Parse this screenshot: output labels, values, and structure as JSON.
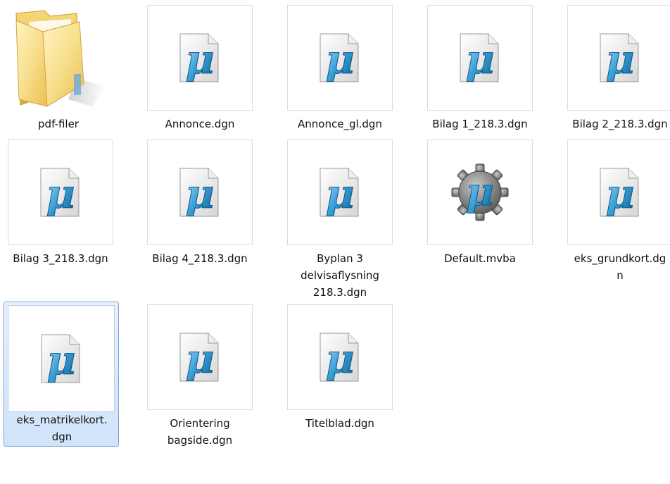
{
  "explorer": {
    "items": [
      {
        "label": "pdf-filer",
        "icon": "folder-icon"
      },
      {
        "label": "Annonce.dgn",
        "icon": "microstation-dgn-icon"
      },
      {
        "label": "Annonce_gl.dgn",
        "icon": "microstation-dgn-icon"
      },
      {
        "label": "Bilag 1_218.3.dgn",
        "icon": "microstation-dgn-icon"
      },
      {
        "label": "Bilag 2_218.3.dgn",
        "icon": "microstation-dgn-icon"
      },
      {
        "label": "Bilag 3_218.3.dgn",
        "icon": "microstation-dgn-icon"
      },
      {
        "label": "Bilag 4_218.3.dgn",
        "icon": "microstation-dgn-icon"
      },
      {
        "label": "Byplan 3\ndelvisaflysning\n218.3.dgn",
        "icon": "microstation-dgn-icon"
      },
      {
        "label": "Default.mvba",
        "icon": "microstation-vba-gear-icon"
      },
      {
        "label": "eks_grundkort.dg\nn",
        "icon": "microstation-dgn-icon"
      },
      {
        "label": "eks_matrikelkort.\ndgn",
        "icon": "microstation-dgn-icon",
        "selected": true
      },
      {
        "label": "Orientering\nbagside.dgn",
        "icon": "microstation-dgn-icon"
      },
      {
        "label": "Titelblad.dgn",
        "icon": "microstation-dgn-icon"
      }
    ]
  }
}
